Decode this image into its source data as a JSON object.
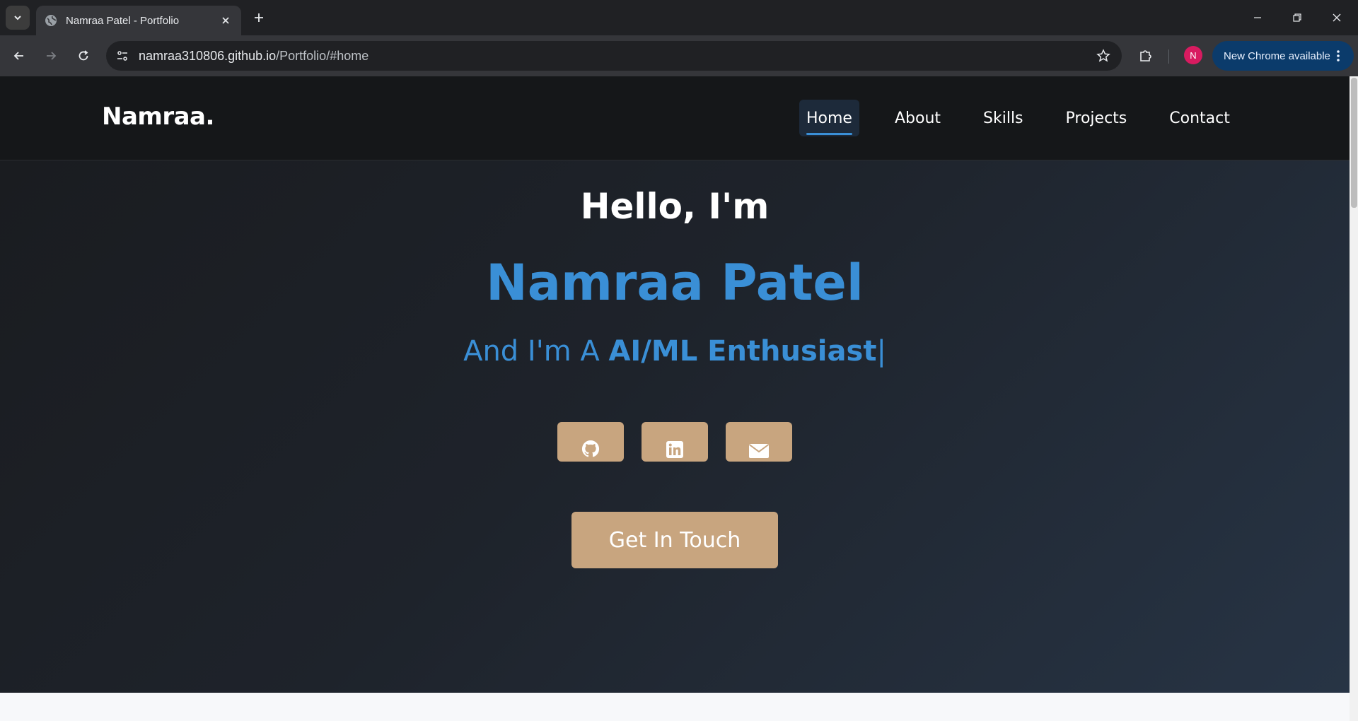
{
  "browser": {
    "tab_title": "Namraa Patel - Portfolio",
    "url_host": "namraa310806.github.io",
    "url_path": "/Portfolio/#home",
    "profile_initial": "N",
    "update_label": "New Chrome available"
  },
  "site": {
    "logo": "Namraa.",
    "nav": {
      "home": "Home",
      "about": "About",
      "skills": "Skills",
      "projects": "Projects",
      "contact": "Contact"
    },
    "hero": {
      "greeting": "Hello, I'm",
      "name": "Namraa Patel",
      "role_prefix": "And I'm A ",
      "role": "AI/ML Enthusiast",
      "cursor": "|",
      "cta": "Get In Touch"
    },
    "socials": [
      "github-icon",
      "linkedin-icon",
      "envelope-icon"
    ]
  },
  "colors": {
    "accent_blue": "#3a8fd6",
    "accent_tan": "#c8a57f",
    "header_bg": "#151719"
  }
}
